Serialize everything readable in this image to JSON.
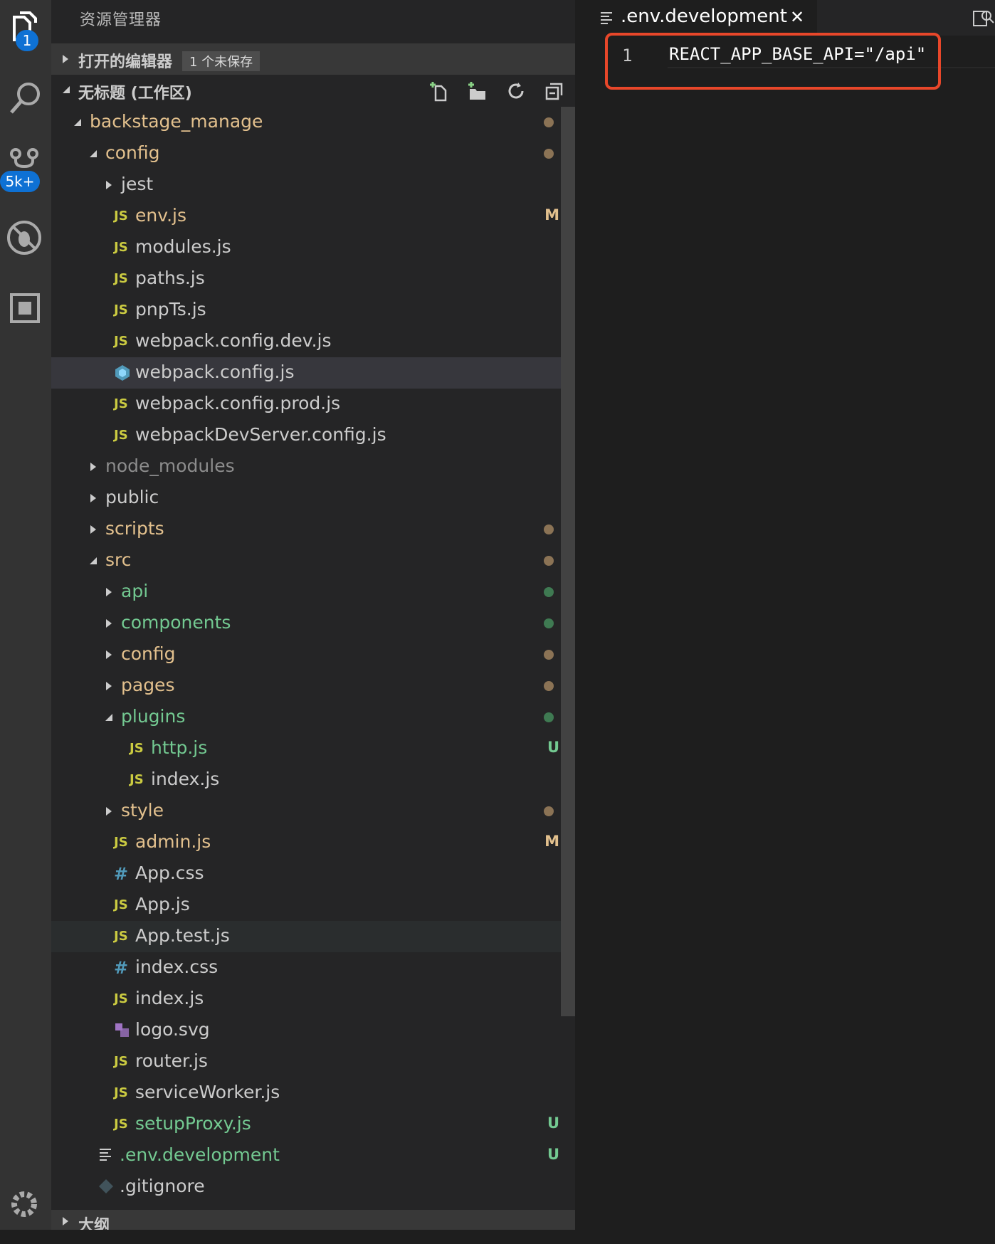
{
  "activity_bar": {
    "explorer_badge": "1",
    "scm_badge": "5k+"
  },
  "sidebar": {
    "title": "资源管理器",
    "open_editors": {
      "label": "打开的编辑器",
      "unsaved": "1 个未保存"
    },
    "workspace": {
      "label": "无标题 (工作区)"
    },
    "outline": {
      "label": "大纲"
    },
    "tree": [
      {
        "name": "backstage_manage",
        "level": 0,
        "type": "folder",
        "open": true,
        "color": "#e2c08d",
        "dot": "#8b7355"
      },
      {
        "name": "config",
        "level": 1,
        "type": "folder",
        "open": true,
        "color": "#e2c08d",
        "dot": "#8b7355"
      },
      {
        "name": "jest",
        "level": 2,
        "type": "folder",
        "open": false,
        "color": "#cccccc"
      },
      {
        "name": "env.js",
        "level": 2,
        "type": "js",
        "color": "#e2c08d",
        "decoration": "M",
        "decoration_color": "#e2c08d"
      },
      {
        "name": "modules.js",
        "level": 2,
        "type": "js",
        "color": "#cccccc"
      },
      {
        "name": "paths.js",
        "level": 2,
        "type": "js",
        "color": "#cccccc"
      },
      {
        "name": "pnpTs.js",
        "level": 2,
        "type": "js",
        "color": "#cccccc"
      },
      {
        "name": "webpack.config.dev.js",
        "level": 2,
        "type": "js",
        "color": "#cccccc"
      },
      {
        "name": "webpack.config.js",
        "level": 2,
        "type": "webpack",
        "color": "#cccccc",
        "selected": true
      },
      {
        "name": "webpack.config.prod.js",
        "level": 2,
        "type": "js",
        "color": "#cccccc"
      },
      {
        "name": "webpackDevServer.config.js",
        "level": 2,
        "type": "js",
        "color": "#cccccc"
      },
      {
        "name": "node_modules",
        "level": 1,
        "type": "folder",
        "open": false,
        "color": "#8c8c8c"
      },
      {
        "name": "public",
        "level": 1,
        "type": "folder",
        "open": false,
        "color": "#cccccc"
      },
      {
        "name": "scripts",
        "level": 1,
        "type": "folder",
        "open": false,
        "color": "#e2c08d",
        "dot": "#8b7355"
      },
      {
        "name": "src",
        "level": 1,
        "type": "folder",
        "open": true,
        "color": "#e2c08d",
        "dot": "#8b7355"
      },
      {
        "name": "api",
        "level": 2,
        "type": "folder",
        "open": false,
        "color": "#73c991",
        "dot": "#3f7a52"
      },
      {
        "name": "components",
        "level": 2,
        "type": "folder",
        "open": false,
        "color": "#73c991",
        "dot": "#3f7a52"
      },
      {
        "name": "config",
        "level": 2,
        "type": "folder",
        "open": false,
        "color": "#e2c08d",
        "dot": "#8b7355"
      },
      {
        "name": "pages",
        "level": 2,
        "type": "folder",
        "open": false,
        "color": "#e2c08d",
        "dot": "#8b7355"
      },
      {
        "name": "plugins",
        "level": 2,
        "type": "folder",
        "open": true,
        "color": "#73c991",
        "dot": "#3f7a52"
      },
      {
        "name": "http.js",
        "level": 3,
        "type": "js",
        "color": "#73c991",
        "decoration": "U",
        "decoration_color": "#73c991"
      },
      {
        "name": "index.js",
        "level": 3,
        "type": "js",
        "color": "#cccccc"
      },
      {
        "name": "style",
        "level": 2,
        "type": "folder",
        "open": false,
        "color": "#e2c08d",
        "dot": "#8b7355"
      },
      {
        "name": "admin.js",
        "level": 2,
        "type": "js",
        "color": "#e2c08d",
        "decoration": "M",
        "decoration_color": "#e2c08d"
      },
      {
        "name": "App.css",
        "level": 2,
        "type": "css",
        "color": "#cccccc"
      },
      {
        "name": "App.js",
        "level": 2,
        "type": "js",
        "color": "#cccccc"
      },
      {
        "name": "App.test.js",
        "level": 2,
        "type": "js",
        "color": "#cccccc",
        "hover": true
      },
      {
        "name": "index.css",
        "level": 2,
        "type": "css",
        "color": "#cccccc"
      },
      {
        "name": "index.js",
        "level": 2,
        "type": "js",
        "color": "#cccccc"
      },
      {
        "name": "logo.svg",
        "level": 2,
        "type": "svg",
        "color": "#cccccc"
      },
      {
        "name": "router.js",
        "level": 2,
        "type": "js",
        "color": "#cccccc"
      },
      {
        "name": "serviceWorker.js",
        "level": 2,
        "type": "js",
        "color": "#cccccc"
      },
      {
        "name": "setupProxy.js",
        "level": 2,
        "type": "js",
        "color": "#73c991",
        "decoration": "U",
        "decoration_color": "#73c991"
      },
      {
        "name": ".env.development",
        "level": 1,
        "type": "text",
        "color": "#73c991",
        "decoration": "U",
        "decoration_color": "#73c991"
      },
      {
        "name": ".gitignore",
        "level": 1,
        "type": "git",
        "color": "#cccccc"
      }
    ]
  },
  "editor": {
    "tab": {
      "name": ".env.development",
      "close": "✕"
    },
    "lines": [
      {
        "number": "1",
        "text": "REACT_APP_BASE_API=\"/api\""
      }
    ]
  },
  "colors": {
    "highlight_box": "#e8472a",
    "badge": "#0e71d4",
    "js_icon": "#cbcb41"
  }
}
